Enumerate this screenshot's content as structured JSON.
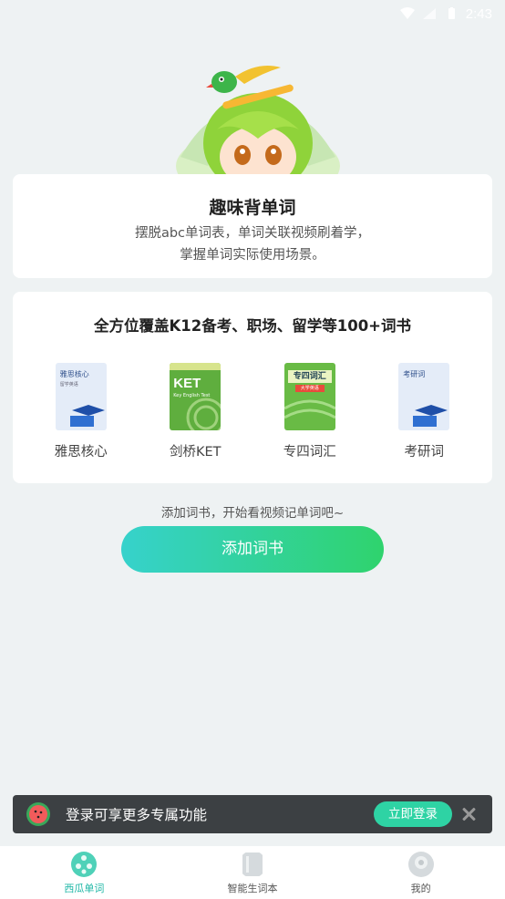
{
  "status_bar": {
    "time": "2:43"
  },
  "intro": {
    "title": "趣味背单词",
    "desc_line1": "摆脱abc单词表，单词关联视频刷着学，",
    "desc_line2": "掌握单词实际使用场景。"
  },
  "books_section": {
    "title": "全方位覆盖K12备考、职场、留学等100+词书",
    "books": [
      {
        "label": "雅思核心",
        "cover_title": "雅思核心",
        "cover_sub": "留学英语"
      },
      {
        "label": "剑桥KET",
        "cover_title": "KET",
        "cover_sub": "Key English Test"
      },
      {
        "label": "专四词汇",
        "cover_title": "专四词汇",
        "cover_sub": "大学英语"
      },
      {
        "label": "考研词",
        "cover_title": "考研词",
        "cover_sub": ""
      }
    ]
  },
  "hint": "添加词书，开始看视频记单词吧~",
  "add_button": "添加词书",
  "login_bar": {
    "text": "登录可享更多专属功能",
    "button": "立即登录"
  },
  "tabbar": {
    "tabs": [
      {
        "label": "西瓜单词",
        "active": true
      },
      {
        "label": "智能生词本",
        "active": false
      },
      {
        "label": "我的",
        "active": false
      }
    ]
  },
  "colors": {
    "accent": "#1fb7a6",
    "button_start": "#36d2cc",
    "button_end": "#2fd36d"
  }
}
